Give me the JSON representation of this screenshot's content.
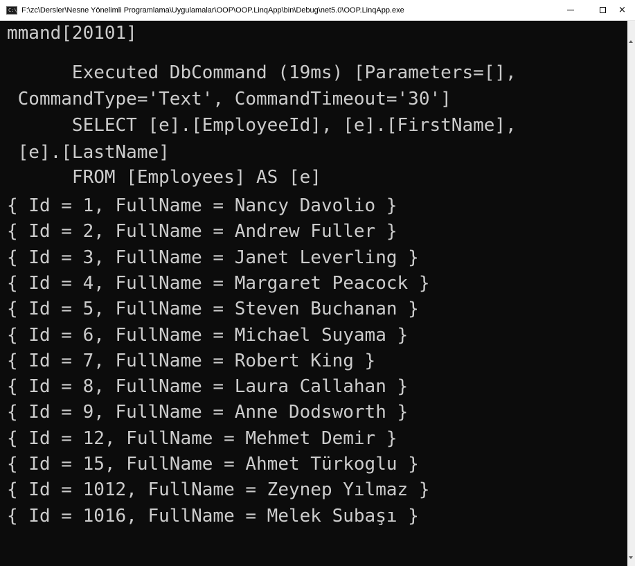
{
  "window": {
    "title": "F:\\zc\\Dersler\\Nesne Yönelimli Programlama\\Uygulamalar\\OOP\\OOP.LinqApp\\bin\\Debug\\net5.0\\OOP.LinqApp.exe",
    "icon_label": "C:\\",
    "icon": "console-app-icon",
    "buttons": {
      "minimize": "minimize-icon",
      "maximize": "maximize-icon",
      "close_label": "×"
    }
  },
  "console": {
    "background": "#0c0c0c",
    "foreground": "#cccccc",
    "lines": [
      "mmand[20101]",
      "      Executed DbCommand (19ms) [Parameters=[],",
      " CommandType='Text', CommandTimeout='30']",
      "      SELECT [e].[EmployeeId], [e].[FirstName],",
      " [e].[LastName]",
      "      FROM [Employees] AS [e]",
      "{ Id = 1, FullName = Nancy Davolio }",
      "{ Id = 2, FullName = Andrew Fuller }",
      "{ Id = 3, FullName = Janet Leverling }",
      "{ Id = 4, FullName = Margaret Peacock }",
      "{ Id = 5, FullName = Steven Buchanan }",
      "{ Id = 6, FullName = Michael Suyama }",
      "{ Id = 7, FullName = Robert King }",
      "{ Id = 8, FullName = Laura Callahan }",
      "{ Id = 9, FullName = Anne Dodsworth }",
      "{ Id = 12, FullName = Mehmet Demir }",
      "{ Id = 15, FullName = Ahmet Türkoglu }",
      "{ Id = 1012, FullName = Zeynep Yılmaz }",
      "{ Id = 1016, FullName = Melek Subaşı }"
    ]
  },
  "scrollbar": {
    "up_icon": "scroll-up-arrow-icon",
    "down_icon": "scroll-down-arrow-icon"
  }
}
